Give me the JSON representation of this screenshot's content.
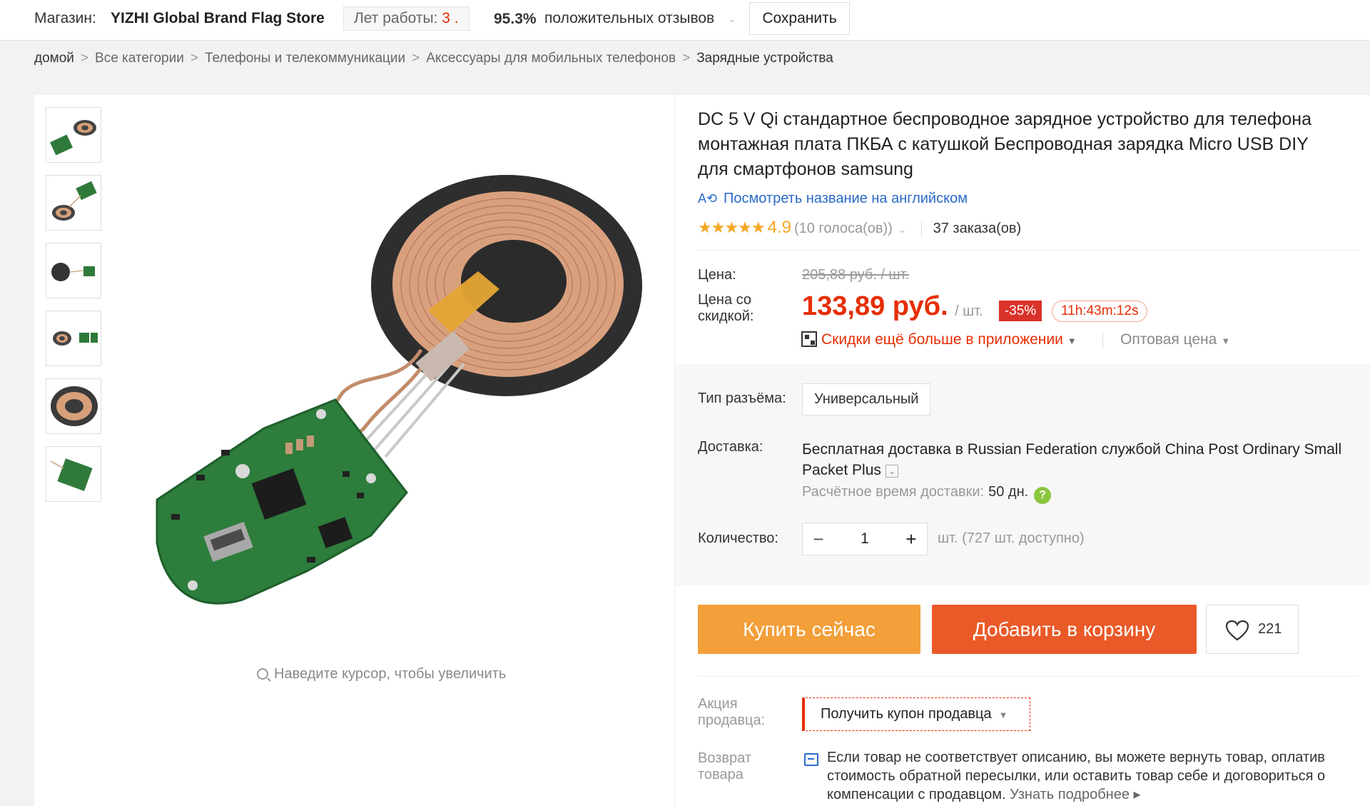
{
  "store": {
    "label": "Магазин:",
    "name": "YIZHI Global Brand Flag Store",
    "years_label": "Лет работы:",
    "years_value": "3 .",
    "positive_pct": "95.3%",
    "positive_label": "положительных отзывов",
    "save_label": "Сохранить"
  },
  "breadcrumb": {
    "items": [
      "домой",
      "Все категории",
      "Телефоны и телекоммуникации",
      "Аксессуары для мобильных телефонов",
      "Зарядные устройства"
    ],
    "separator": ">"
  },
  "gallery": {
    "zoom_hint": "Наведите курсор, чтобы увеличить",
    "thumbnails": [
      "thumb-1",
      "thumb-2",
      "thumb-3",
      "thumb-4",
      "thumb-5",
      "thumb-6"
    ]
  },
  "product": {
    "title": "DC 5 V Qi стандартное беспроводное зарядное устройство для телефона монтажная плата ПКБА с катушкой Беспроводная зарядка Micro USB DIY для смартфонов samsung",
    "translate_link": "Посмотреть название на английском",
    "stars": "★★★★★",
    "rating": "4.9",
    "votes": "(10 голоса(ов))",
    "orders": "37 заказа(ов)"
  },
  "price": {
    "label": "Цена:",
    "old": "205,88 руб. / шт.",
    "discount_label": "Цена со скидкой:",
    "new": "133,89 руб.",
    "per_unit": "/ шт.",
    "discount_badge": "-35%",
    "timer": "11h:43m:12s",
    "app_discount": "Скидки ещё больше в приложении",
    "wholesale": "Оптовая цена"
  },
  "options": {
    "connector_label": "Тип разъёма:",
    "connector_value": "Универсальный",
    "shipping_label": "Доставка:",
    "shipping_bold": "Бесплатная доставка",
    "shipping_rest": " в Russian Federation службой China Post Ordinary Small Packet Plus",
    "eta_label": "Расчётное время доставки:",
    "eta_days": "50 дн.",
    "quantity_label": "Количество:",
    "quantity_value": "1",
    "availability": "шт. (727 шт. доступно)"
  },
  "actions": {
    "buy_now": "Купить сейчас",
    "add_to_cart": "Добавить в корзину",
    "wishlist_count": "221"
  },
  "promo": {
    "label": "Акция продавца:",
    "coupon": "Получить купон продавца",
    "return_label": "Возврат товара",
    "return_text": "Если товар не соответствует описанию, вы можете вернуть товар, оплатив стоимость обратной пересылки, или оставить товар себе и договориться о компенсации с продавцом. ",
    "return_link": "Узнать подробнее"
  },
  "colors": {
    "accent_red": "#e62e04",
    "buy_orange": "#f39f3a",
    "cart_orange": "#ea5a28",
    "link_blue": "#2a6ac8",
    "star_gold": "#f5a623"
  }
}
